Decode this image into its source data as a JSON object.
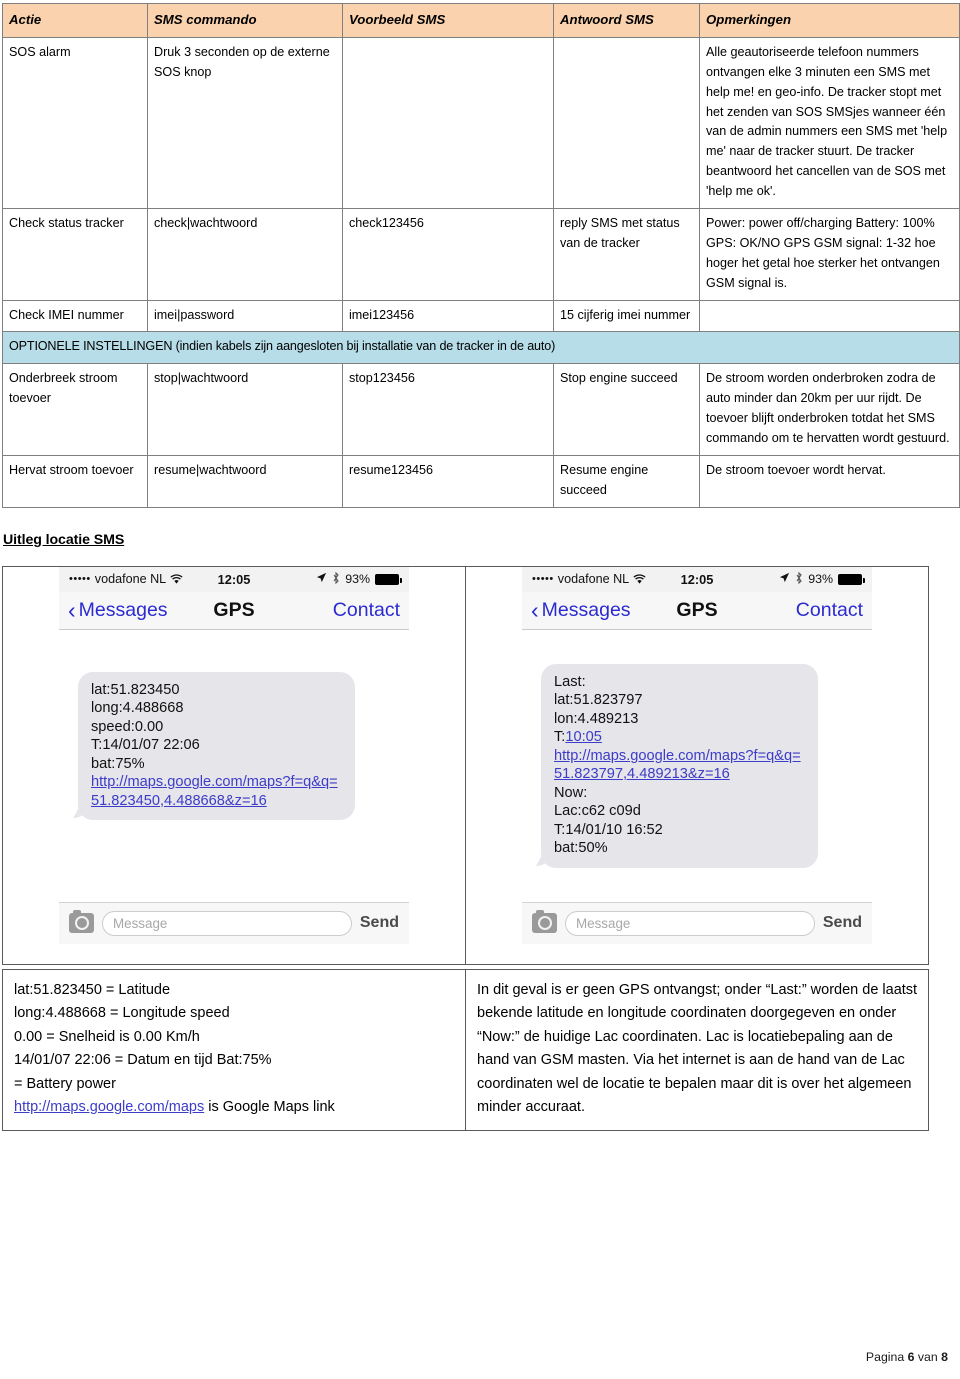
{
  "command_table": {
    "headers": [
      "Actie",
      "SMS commando",
      "Voorbeeld SMS",
      "Antwoord SMS",
      "Opmerkingen"
    ],
    "rows": [
      {
        "actie": "SOS alarm",
        "commando": "Druk 3 seconden op de externe SOS knop",
        "voorbeeld": "",
        "antwoord": "",
        "opmerkingen": "Alle geautoriseerde telefoon nummers ontvangen elke 3 minuten een SMS met help me! en geo-info. De tracker stopt met het zenden van SOS SMSjes wanneer één van de admin nummers een SMS met 'help me' naar de tracker stuurt. De tracker beantwoord het cancellen van de SOS met 'help me ok'."
      },
      {
        "actie": "Check status tracker",
        "commando": "check|wachtwoord",
        "voorbeeld": "check123456",
        "antwoord": "reply SMS met status van de tracker",
        "opmerkingen": "Power: power off/charging Battery: 100% GPS: OK/NO GPS GSM signal: 1-32 hoe hoger het getal hoe sterker het ontvangen GSM signal is."
      },
      {
        "actie": "Check IMEI nummer",
        "commando": "imei|password",
        "voorbeeld": "imei123456",
        "antwoord": "15 cijferig imei nummer",
        "opmerkingen": ""
      }
    ],
    "section_banner": "OPTIONELE INSTELLINGEN (indien kabels zijn aangesloten bij installatie van de tracker in de auto)",
    "optional_rows": [
      {
        "actie": "Onderbreek stroom toevoer",
        "commando": "stop|wachtwoord",
        "voorbeeld": "stop123456",
        "antwoord": "Stop engine succeed",
        "opmerkingen": "De stroom worden onderbroken zodra de auto minder dan 20km per uur rijdt. De toevoer blijft onderbroken totdat het SMS commando om te hervatten wordt gestuurd."
      },
      {
        "actie": "Hervat stroom toevoer",
        "commando": "resume|wachtwoord",
        "voorbeeld": "resume123456",
        "antwoord": "Resume engine succeed",
        "opmerkingen": "De stroom toevoer wordt hervat."
      }
    ]
  },
  "subheading": "Uitleg locatie SMS",
  "phones": [
    {
      "status": {
        "signal_dots": "•••••",
        "carrier": "vodafone NL",
        "wifi_icon": "wifi-icon",
        "time": "12:05",
        "location_icon": "location-arrow-icon",
        "bluetooth_icon": "bluetooth-icon",
        "battery_percent": "93%",
        "battery_icon": "battery-icon"
      },
      "nav": {
        "back_icon": "chevron-left-icon",
        "back_label": "Messages",
        "title": "GPS",
        "right_label": "Contact"
      },
      "bubble_lines": [
        {
          "text": "lat:51.823450",
          "link": false
        },
        {
          "text": "long:4.488668",
          "link": false
        },
        {
          "text": "speed:0.00",
          "link": false
        },
        {
          "text": "T:14/01/07 22:06",
          "link": false
        },
        {
          "text": "bat:75%",
          "link": false
        },
        {
          "text": "http://maps.google.com/maps?f=q&q=51.823450,4.488668&z=16",
          "link": true
        }
      ],
      "toolbar": {
        "camera_icon": "camera-icon",
        "placeholder": "Message",
        "send_label": "Send"
      }
    },
    {
      "status": {
        "signal_dots": "•••••",
        "carrier": "vodafone NL",
        "wifi_icon": "wifi-icon",
        "time": "12:05",
        "location_icon": "location-arrow-icon",
        "bluetooth_icon": "bluetooth-icon",
        "battery_percent": "93%",
        "battery_icon": "battery-icon"
      },
      "nav": {
        "back_icon": "chevron-left-icon",
        "back_label": "Messages",
        "title": "GPS",
        "right_label": "Contact"
      },
      "bubble_lines": [
        {
          "text": "Last:",
          "link": false
        },
        {
          "text": "lat:51.823797",
          "link": false
        },
        {
          "text": "lon:4.489213",
          "link": false
        },
        {
          "text": "T:",
          "link": false,
          "suffix_link": "10:05"
        },
        {
          "text": "http://maps.google.com/maps?f=q&q=51.823797,4.489213&z=16",
          "link": true
        },
        {
          "text": "Now:",
          "link": false
        },
        {
          "text": "Lac:c62 c09d",
          "link": false
        },
        {
          "text": "T:14/01/10 16:52",
          "link": false
        },
        {
          "text": "bat:50%",
          "link": false
        }
      ],
      "toolbar": {
        "camera_icon": "camera-icon",
        "placeholder": "Message",
        "send_label": "Send"
      }
    }
  ],
  "explanation": {
    "left_lines": [
      "lat:51.823450 = Latitude",
      "long:4.488668 = Longitude speed",
      "0.00 = Snelheid is 0.00 Km/h",
      "14/01/07 22:06 = Datum en tijd Bat:75%",
      "= Battery power"
    ],
    "left_link_line": {
      "link_text": "http://maps.google.com/maps",
      "tail": " is Google Maps link"
    },
    "right_text": "In dit geval is er geen GPS ontvangst; onder “Last:” worden de laatst bekende latitude en longitude coordinaten doorgegeven en onder “Now:” de huidige Lac coordinaten. Lac is locatiebepaling aan de hand van GSM masten. Via het internet is aan de hand van de Lac coordinaten wel de locatie te bepalen maar dit is over het algemeen minder accuraat."
  },
  "footer": {
    "prefix": "Pagina ",
    "page": "6",
    "middle": " van ",
    "total": "8"
  },
  "colors": {
    "header_fill": "#fad2ad",
    "banner_fill": "#b7dde8",
    "link": "#3c3cc8",
    "ios_blue": "#2b2bd0",
    "bubble": "#e6e5ea"
  }
}
